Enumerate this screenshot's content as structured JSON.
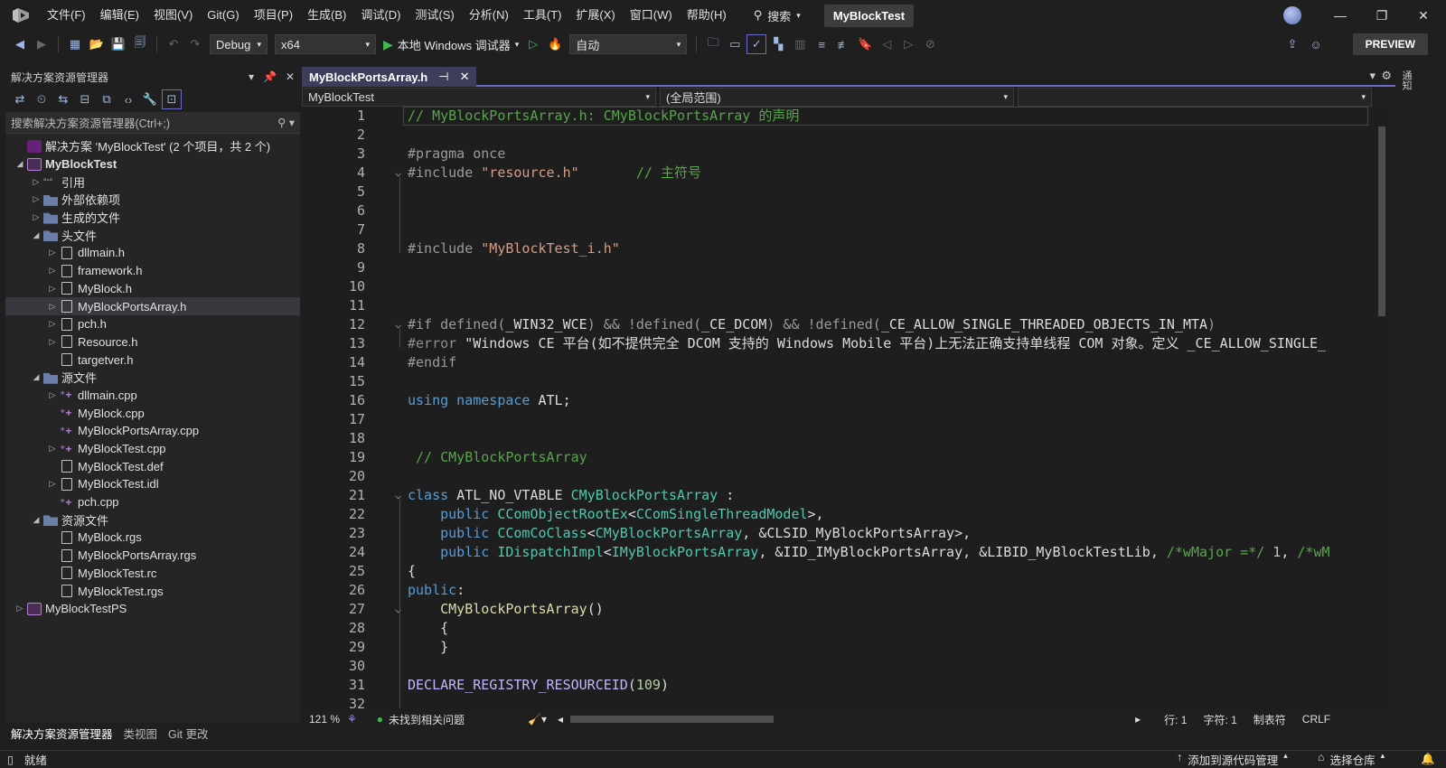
{
  "menu": [
    "文件(F)",
    "编辑(E)",
    "视图(V)",
    "Git(G)",
    "项目(P)",
    "生成(B)",
    "调试(D)",
    "测试(S)",
    "分析(N)",
    "工具(T)",
    "扩展(X)",
    "窗口(W)",
    "帮助(H)"
  ],
  "search_label": "搜索",
  "solution_title": "MyBlockTest",
  "toolbar": {
    "config": "Debug",
    "platform": "x64",
    "run_label": "本地 Windows 调试器",
    "auto": "自动",
    "preview": "PREVIEW"
  },
  "solution_explorer": {
    "title": "解决方案资源管理器",
    "search_placeholder": "搜索解决方案资源管理器(Ctrl+;)",
    "tree": [
      {
        "label": "解决方案 'MyBlockTest' (2 个项目，共 2 个)",
        "depth": 0,
        "icon": "solution-icon",
        "toggle": "none"
      },
      {
        "label": "MyBlockTest",
        "depth": 0,
        "icon": "project-icon",
        "toggle": "expanded",
        "bold": true
      },
      {
        "label": "引用",
        "depth": 1,
        "icon": "references-icon",
        "toggle": "collapsed"
      },
      {
        "label": "外部依赖项",
        "depth": 1,
        "icon": "folder-icon",
        "toggle": "collapsed"
      },
      {
        "label": "生成的文件",
        "depth": 1,
        "icon": "folder-icon",
        "toggle": "collapsed"
      },
      {
        "label": "头文件",
        "depth": 1,
        "icon": "folder-icon",
        "toggle": "expanded"
      },
      {
        "label": "dllmain.h",
        "depth": 2,
        "icon": "header-file-icon",
        "toggle": "collapsed"
      },
      {
        "label": "framework.h",
        "depth": 2,
        "icon": "header-file-icon",
        "toggle": "collapsed"
      },
      {
        "label": "MyBlock.h",
        "depth": 2,
        "icon": "header-file-icon",
        "toggle": "collapsed"
      },
      {
        "label": "MyBlockPortsArray.h",
        "depth": 2,
        "icon": "header-file-icon",
        "toggle": "collapsed",
        "selected": true
      },
      {
        "label": "pch.h",
        "depth": 2,
        "icon": "header-file-icon",
        "toggle": "collapsed"
      },
      {
        "label": "Resource.h",
        "depth": 2,
        "icon": "header-file-icon",
        "toggle": "collapsed"
      },
      {
        "label": "targetver.h",
        "depth": 2,
        "icon": "header-file-icon",
        "toggle": "none"
      },
      {
        "label": "源文件",
        "depth": 1,
        "icon": "folder-icon",
        "toggle": "expanded"
      },
      {
        "label": "dllmain.cpp",
        "depth": 2,
        "icon": "cpp-file-icon",
        "toggle": "collapsed"
      },
      {
        "label": "MyBlock.cpp",
        "depth": 2,
        "icon": "cpp-file-icon",
        "toggle": "none"
      },
      {
        "label": "MyBlockPortsArray.cpp",
        "depth": 2,
        "icon": "cpp-file-icon",
        "toggle": "none"
      },
      {
        "label": "MyBlockTest.cpp",
        "depth": 2,
        "icon": "cpp-file-icon",
        "toggle": "collapsed"
      },
      {
        "label": "MyBlockTest.def",
        "depth": 2,
        "icon": "def-file-icon",
        "toggle": "none"
      },
      {
        "label": "MyBlockTest.idl",
        "depth": 2,
        "icon": "idl-file-icon",
        "toggle": "collapsed"
      },
      {
        "label": "pch.cpp",
        "depth": 2,
        "icon": "cpp-file-icon",
        "toggle": "none"
      },
      {
        "label": "资源文件",
        "depth": 1,
        "icon": "folder-icon",
        "toggle": "expanded"
      },
      {
        "label": "MyBlock.rgs",
        "depth": 2,
        "icon": "rgs-file-icon",
        "toggle": "none"
      },
      {
        "label": "MyBlockPortsArray.rgs",
        "depth": 2,
        "icon": "rgs-file-icon",
        "toggle": "none"
      },
      {
        "label": "MyBlockTest.rc",
        "depth": 2,
        "icon": "rc-file-icon",
        "toggle": "none"
      },
      {
        "label": "MyBlockTest.rgs",
        "depth": 2,
        "icon": "rgs-file-icon",
        "toggle": "none"
      },
      {
        "label": "MyBlockTestPS",
        "depth": 0,
        "icon": "project-icon",
        "toggle": "collapsed"
      }
    ],
    "bottom_tabs": [
      "解决方案资源管理器",
      "类视图",
      "Git 更改"
    ]
  },
  "editor": {
    "tab_title": "MyBlockPortsArray.h",
    "nav_project": "MyBlockTest",
    "nav_scope": "(全局范围)",
    "lines": [
      {
        "n": "1",
        "fold": "",
        "tokens": [
          [
            "c-com",
            "// MyBlockPortsArray.h: CMyBlockPortsArray 的声明"
          ]
        ]
      },
      {
        "n": "2",
        "fold": "",
        "tokens": []
      },
      {
        "n": "3",
        "fold": "",
        "tokens": [
          [
            "c-pre",
            "#pragma once"
          ]
        ]
      },
      {
        "n": "4",
        "fold": "⌵",
        "tokens": [
          [
            "c-pre",
            "#include "
          ],
          [
            "c-str",
            "\"resource.h\""
          ],
          [
            "c-plain",
            "       "
          ],
          [
            "c-com",
            "// 主符号"
          ]
        ]
      },
      {
        "n": "5",
        "fold": "",
        "tokens": []
      },
      {
        "n": "6",
        "fold": "",
        "tokens": []
      },
      {
        "n": "7",
        "fold": "",
        "tokens": []
      },
      {
        "n": "8",
        "fold": "",
        "tokens": [
          [
            "c-pre",
            "#include "
          ],
          [
            "c-str",
            "\"MyBlockTest_i.h\""
          ]
        ]
      },
      {
        "n": "9",
        "fold": "",
        "tokens": []
      },
      {
        "n": "10",
        "fold": "",
        "tokens": []
      },
      {
        "n": "11",
        "fold": "",
        "tokens": []
      },
      {
        "n": "12",
        "fold": "⌵",
        "tokens": [
          [
            "c-pre",
            "#if defined("
          ],
          [
            "c-plain",
            "_WIN32_WCE"
          ],
          [
            "c-pre",
            ") && !defined("
          ],
          [
            "c-plain",
            "_CE_DCOM"
          ],
          [
            "c-pre",
            ") && !defined("
          ],
          [
            "c-plain",
            "_CE_ALLOW_SINGLE_THREADED_OBJECTS_IN_MTA"
          ],
          [
            "c-pre",
            ")"
          ]
        ]
      },
      {
        "n": "13",
        "fold": "",
        "tokens": [
          [
            "c-dim",
            "#error "
          ],
          [
            "c-plain",
            "\"Windows CE 平台(如不提供完全 DCOM 支持的 Windows Mobile 平台)上无法正确支持单线程 COM 对象。定义 _CE_ALLOW_SINGLE_"
          ]
        ]
      },
      {
        "n": "14",
        "fold": "",
        "tokens": [
          [
            "c-pre",
            "#endif"
          ]
        ]
      },
      {
        "n": "15",
        "fold": "",
        "tokens": []
      },
      {
        "n": "16",
        "fold": "",
        "tokens": [
          [
            "c-kw",
            "using namespace "
          ],
          [
            "c-plain",
            "ATL;"
          ]
        ]
      },
      {
        "n": "17",
        "fold": "",
        "tokens": []
      },
      {
        "n": "18",
        "fold": "",
        "tokens": []
      },
      {
        "n": "19",
        "fold": "",
        "tokens": [
          [
            "c-com",
            " // CMyBlockPortsArray"
          ]
        ]
      },
      {
        "n": "20",
        "fold": "",
        "tokens": []
      },
      {
        "n": "21",
        "fold": "⌵",
        "tokens": [
          [
            "c-kw",
            "class "
          ],
          [
            "c-plain",
            "ATL_NO_VTABLE "
          ],
          [
            "c-type",
            "CMyBlockPortsArray"
          ],
          [
            "c-plain",
            " :"
          ]
        ]
      },
      {
        "n": "22",
        "fold": "",
        "tokens": [
          [
            "c-kw",
            "    public "
          ],
          [
            "c-type",
            "CComObjectRootEx"
          ],
          [
            "c-plain",
            "<"
          ],
          [
            "c-type",
            "CComSingleThreadModel"
          ],
          [
            "c-plain",
            ">,"
          ]
        ]
      },
      {
        "n": "23",
        "fold": "",
        "tokens": [
          [
            "c-kw",
            "    public "
          ],
          [
            "c-type",
            "CComCoClass"
          ],
          [
            "c-plain",
            "<"
          ],
          [
            "c-type",
            "CMyBlockPortsArray"
          ],
          [
            "c-plain",
            ", &CLSID_MyBlockPortsArray>,"
          ]
        ]
      },
      {
        "n": "24",
        "fold": "",
        "tokens": [
          [
            "c-kw",
            "    public "
          ],
          [
            "c-type",
            "IDispatchImpl"
          ],
          [
            "c-plain",
            "<"
          ],
          [
            "c-type",
            "IMyBlockPortsArray"
          ],
          [
            "c-plain",
            ", &IID_IMyBlockPortsArray, &LIBID_MyBlockTestLib, "
          ],
          [
            "c-com",
            "/*wMajor =*/"
          ],
          [
            "c-plain",
            " "
          ],
          [
            "c-num",
            "1"
          ],
          [
            "c-plain",
            ", "
          ],
          [
            "c-com",
            "/*wM"
          ]
        ]
      },
      {
        "n": "25",
        "fold": "",
        "tokens": [
          [
            "c-plain",
            "{"
          ]
        ]
      },
      {
        "n": "26",
        "fold": "",
        "tokens": [
          [
            "c-kw",
            "public"
          ],
          [
            "c-plain",
            ":"
          ]
        ]
      },
      {
        "n": "27",
        "fold": "⌵",
        "tokens": [
          [
            "c-plain",
            "    "
          ],
          [
            "c-fn",
            "CMyBlockPortsArray"
          ],
          [
            "c-plain",
            "()"
          ]
        ]
      },
      {
        "n": "28",
        "fold": "",
        "tokens": [
          [
            "c-plain",
            "    {"
          ]
        ]
      },
      {
        "n": "29",
        "fold": "",
        "tokens": [
          [
            "c-plain",
            "    }"
          ]
        ]
      },
      {
        "n": "30",
        "fold": "",
        "tokens": []
      },
      {
        "n": "31",
        "fold": "",
        "tokens": [
          [
            "c-macro",
            "DECLARE_REGISTRY_RESOURCEID"
          ],
          [
            "c-plain",
            "("
          ],
          [
            "c-num",
            "109"
          ],
          [
            "c-plain",
            ")"
          ]
        ]
      },
      {
        "n": "32",
        "fold": "",
        "tokens": []
      }
    ],
    "zoom": "121 %",
    "issues": "未找到相关问题",
    "line_col": "行: 1",
    "char_col": "字符: 1",
    "tabs_mode": "制表符",
    "eol": "CRLF"
  },
  "status": {
    "ready": "就绪",
    "add_to_source": "添加到源代码管理",
    "select_repo": "选择仓库"
  },
  "right_strip": "通知"
}
